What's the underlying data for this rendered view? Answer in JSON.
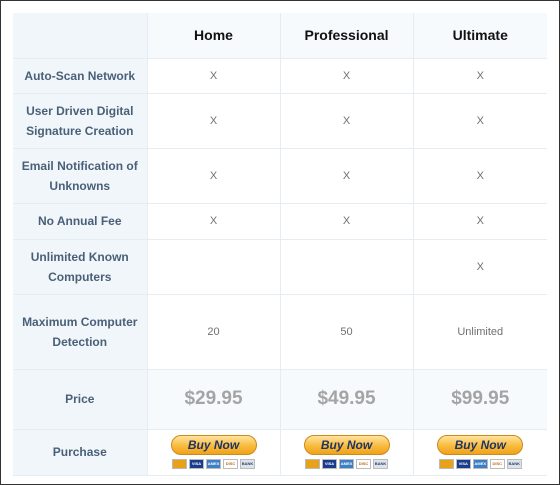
{
  "plans": [
    "Home",
    "Professional",
    "Ultimate"
  ],
  "features": [
    {
      "label": "Auto-Scan Network",
      "values": [
        "X",
        "X",
        "X"
      ]
    },
    {
      "label": "User Driven Digital Signature Creation",
      "values": [
        "X",
        "X",
        "X"
      ]
    },
    {
      "label": "Email Notification of Unknowns",
      "values": [
        "X",
        "X",
        "X"
      ]
    },
    {
      "label": "No Annual Fee",
      "values": [
        "X",
        "X",
        "X"
      ]
    },
    {
      "label": "Unlimited Known Computers",
      "values": [
        "",
        "",
        "X"
      ]
    },
    {
      "label": "Maximum Computer Detection",
      "values": [
        "20",
        "50",
        "Unlimited"
      ]
    }
  ],
  "price": {
    "label": "Price",
    "values": [
      "$29.95",
      "$49.95",
      "$99.95"
    ]
  },
  "purchase": {
    "label": "Purchase",
    "button_label": "Buy Now",
    "cards": [
      "mastercard-icon",
      "visa-icon",
      "amex-icon",
      "discover-icon",
      "bank-icon"
    ]
  },
  "card_labels": {
    "visa": "VISA",
    "amex": "AMEX",
    "discover": "DISC",
    "bank": "BANK"
  },
  "colors": {
    "feature_text": "#4a6078",
    "price_text": "#a4a4a4",
    "button": "#f8bb3c",
    "button_text": "#1e3465"
  }
}
